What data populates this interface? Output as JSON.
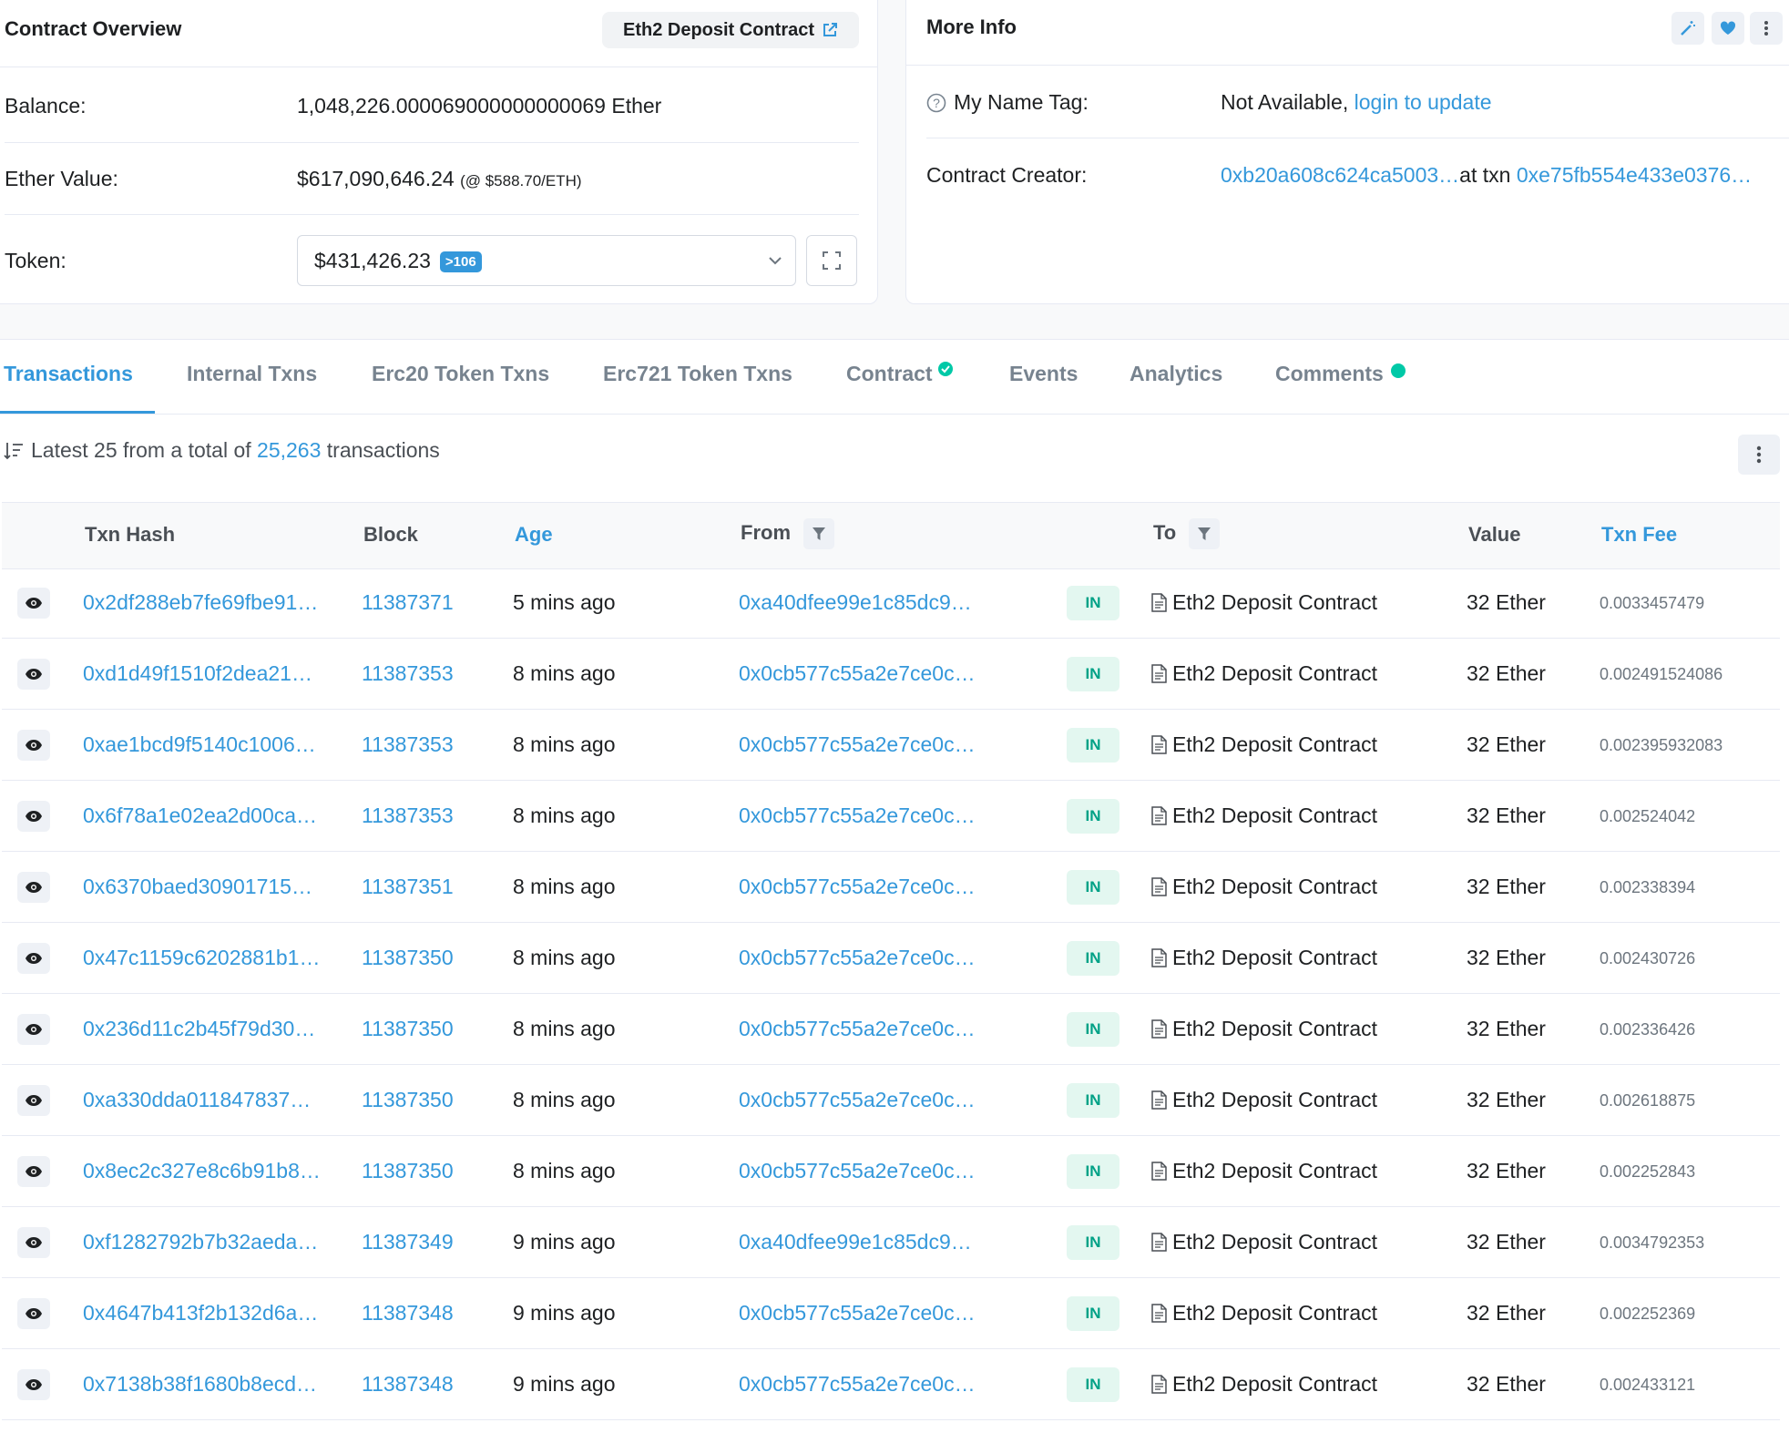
{
  "overview": {
    "title": "Contract Overview",
    "contract_button": "Eth2 Deposit Contract",
    "balance_label": "Balance:",
    "balance_value": "1,048,226.000069000000000069 Ether",
    "ether_value_label": "Ether Value:",
    "ether_value": "$617,090,646.24",
    "ether_price": "(@ $588.70/ETH)",
    "token_label": "Token:",
    "token_value": "$431,426.23",
    "token_count": ">106"
  },
  "more_info": {
    "title": "More Info",
    "name_tag_label": "My Name Tag:",
    "name_tag_value": "Not Available,",
    "name_tag_link": "login to update",
    "creator_label": "Contract Creator:",
    "creator_address": "0xb20a608c624ca5003…",
    "creator_at_txn": "at txn",
    "creator_txn": "0xe75fb554e433e0376…"
  },
  "tabs": [
    {
      "label": "Transactions"
    },
    {
      "label": "Internal Txns"
    },
    {
      "label": "Erc20 Token Txns"
    },
    {
      "label": "Erc721 Token Txns"
    },
    {
      "label": "Contract"
    },
    {
      "label": "Events"
    },
    {
      "label": "Analytics"
    },
    {
      "label": "Comments"
    }
  ],
  "summary": {
    "prefix": "Latest 25 from a total of",
    "count": "25,263",
    "suffix": "transactions"
  },
  "table": {
    "headers": {
      "hash": "Txn Hash",
      "block": "Block",
      "age": "Age",
      "from": "From",
      "to": "To",
      "value": "Value",
      "fee": "Txn Fee"
    },
    "rows": [
      {
        "hash": "0x2df288eb7fe69fbe91…",
        "block": "11387371",
        "age": "5 mins ago",
        "from": "0xa40dfee99e1c85dc9…",
        "dir": "IN",
        "to": "Eth2 Deposit Contract",
        "value": "32 Ether",
        "fee": "0.0033457479"
      },
      {
        "hash": "0xd1d49f1510f2dea21…",
        "block": "11387353",
        "age": "8 mins ago",
        "from": "0x0cb577c55a2e7ce0c…",
        "dir": "IN",
        "to": "Eth2 Deposit Contract",
        "value": "32 Ether",
        "fee": "0.002491524086"
      },
      {
        "hash": "0xae1bcd9f5140c1006…",
        "block": "11387353",
        "age": "8 mins ago",
        "from": "0x0cb577c55a2e7ce0c…",
        "dir": "IN",
        "to": "Eth2 Deposit Contract",
        "value": "32 Ether",
        "fee": "0.002395932083"
      },
      {
        "hash": "0x6f78a1e02ea2d00ca…",
        "block": "11387353",
        "age": "8 mins ago",
        "from": "0x0cb577c55a2e7ce0c…",
        "dir": "IN",
        "to": "Eth2 Deposit Contract",
        "value": "32 Ether",
        "fee": "0.002524042"
      },
      {
        "hash": "0x6370baed30901715…",
        "block": "11387351",
        "age": "8 mins ago",
        "from": "0x0cb577c55a2e7ce0c…",
        "dir": "IN",
        "to": "Eth2 Deposit Contract",
        "value": "32 Ether",
        "fee": "0.002338394"
      },
      {
        "hash": "0x47c1159c6202881b1…",
        "block": "11387350",
        "age": "8 mins ago",
        "from": "0x0cb577c55a2e7ce0c…",
        "dir": "IN",
        "to": "Eth2 Deposit Contract",
        "value": "32 Ether",
        "fee": "0.002430726"
      },
      {
        "hash": "0x236d11c2b45f79d30…",
        "block": "11387350",
        "age": "8 mins ago",
        "from": "0x0cb577c55a2e7ce0c…",
        "dir": "IN",
        "to": "Eth2 Deposit Contract",
        "value": "32 Ether",
        "fee": "0.002336426"
      },
      {
        "hash": "0xa330dda011847837…",
        "block": "11387350",
        "age": "8 mins ago",
        "from": "0x0cb577c55a2e7ce0c…",
        "dir": "IN",
        "to": "Eth2 Deposit Contract",
        "value": "32 Ether",
        "fee": "0.002618875"
      },
      {
        "hash": "0x8ec2c327e8c6b91b8…",
        "block": "11387350",
        "age": "8 mins ago",
        "from": "0x0cb577c55a2e7ce0c…",
        "dir": "IN",
        "to": "Eth2 Deposit Contract",
        "value": "32 Ether",
        "fee": "0.002252843"
      },
      {
        "hash": "0xf1282792b7b32aeda…",
        "block": "11387349",
        "age": "9 mins ago",
        "from": "0xa40dfee99e1c85dc9…",
        "dir": "IN",
        "to": "Eth2 Deposit Contract",
        "value": "32 Ether",
        "fee": "0.0034792353"
      },
      {
        "hash": "0x4647b413f2b132d6a…",
        "block": "11387348",
        "age": "9 mins ago",
        "from": "0x0cb577c55a2e7ce0c…",
        "dir": "IN",
        "to": "Eth2 Deposit Contract",
        "value": "32 Ether",
        "fee": "0.002252369"
      },
      {
        "hash": "0x7138b38f1680b8ecd…",
        "block": "11387348",
        "age": "9 mins ago",
        "from": "0x0cb577c55a2e7ce0c…",
        "dir": "IN",
        "to": "Eth2 Deposit Contract",
        "value": "32 Ether",
        "fee": "0.002433121"
      }
    ]
  }
}
